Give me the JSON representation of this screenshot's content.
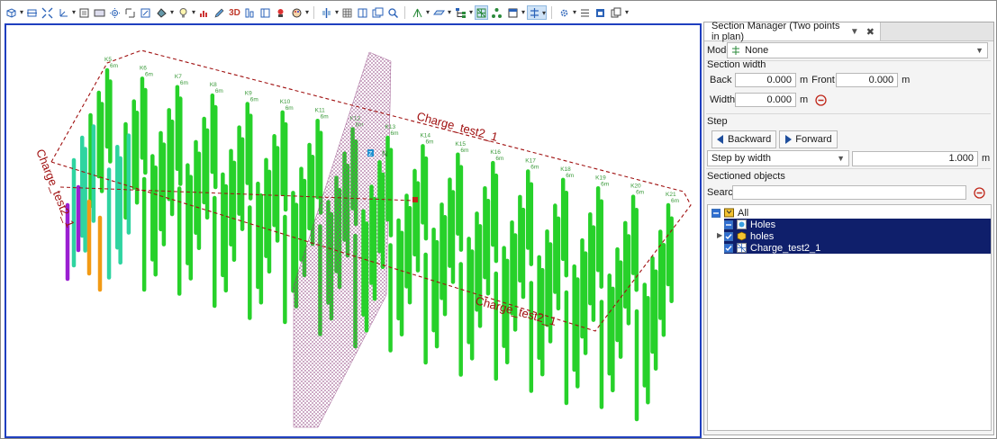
{
  "toolbar": {
    "icons": [
      "view-cube-icon",
      "fit-width-icon",
      "zoom-extents-icon",
      "axes-icon",
      "box-icon",
      "rect-icon",
      "snap-icon",
      "frame-icon",
      "zoom-box-icon",
      "fill-icon",
      "lightbulb-icon",
      "chart-icon",
      "pencil-icon",
      "text-3d-icon",
      "column-icon",
      "layers-icon",
      "stamp-icon",
      "palette-icon",
      "split-icon",
      "grid-icon",
      "panel-icon",
      "window-icon",
      "search-icon",
      "tripod-icon",
      "plane-icon",
      "hierarchy-icon",
      "mesh-icon",
      "network-icon",
      "frame2-icon",
      "section-icon",
      "settings-icon",
      "list-icon",
      "window2-icon",
      "copy-icon"
    ],
    "label_3d": "3D"
  },
  "viewport": {
    "section_label_1": "Charge_test2_1",
    "section_label_2": "Charge_test2_1",
    "section_label_3": "Charge_test2_1",
    "marker_label": "N",
    "marker_z": "Z",
    "hole_labels": [
      "K5",
      "K6",
      "K7",
      "K8",
      "K9",
      "K10",
      "K11",
      "K12",
      "K13",
      "K14",
      "K15",
      "K16",
      "K17",
      "K18",
      "K19",
      "K20",
      "K21"
    ],
    "depth_label": "6m"
  },
  "panel": {
    "title": "Section Manager (Two points in plan)",
    "pin_glyph": "▼",
    "close_glyph": "✖",
    "mode_label": "Mode",
    "mode_value": "None",
    "section_width_title": "Section width",
    "back_label": "Back",
    "back_value": "0.000",
    "back_unit": "m",
    "front_label": "Front",
    "front_value": "0.000",
    "front_unit": "m",
    "width_label": "Width",
    "width_value": "0.000",
    "width_unit": "m",
    "step_title": "Step",
    "backward_label": "Backward",
    "forward_label": "Forward",
    "step_mode": "Step by width",
    "step_value": "1.000",
    "step_unit": "m",
    "sectioned_title": "Sectioned objects",
    "search_label": "Search",
    "search_value": "",
    "tree": [
      {
        "label": "All",
        "state": "partial",
        "icon": "folder-icon"
      },
      {
        "label": "Holes",
        "state": "partial",
        "icon": "holes-icon"
      },
      {
        "label": "holes",
        "state": "checked",
        "icon": "cube-icon"
      },
      {
        "label": "Charge_test2_1",
        "state": "checked",
        "icon": "mesh-icon"
      }
    ]
  }
}
